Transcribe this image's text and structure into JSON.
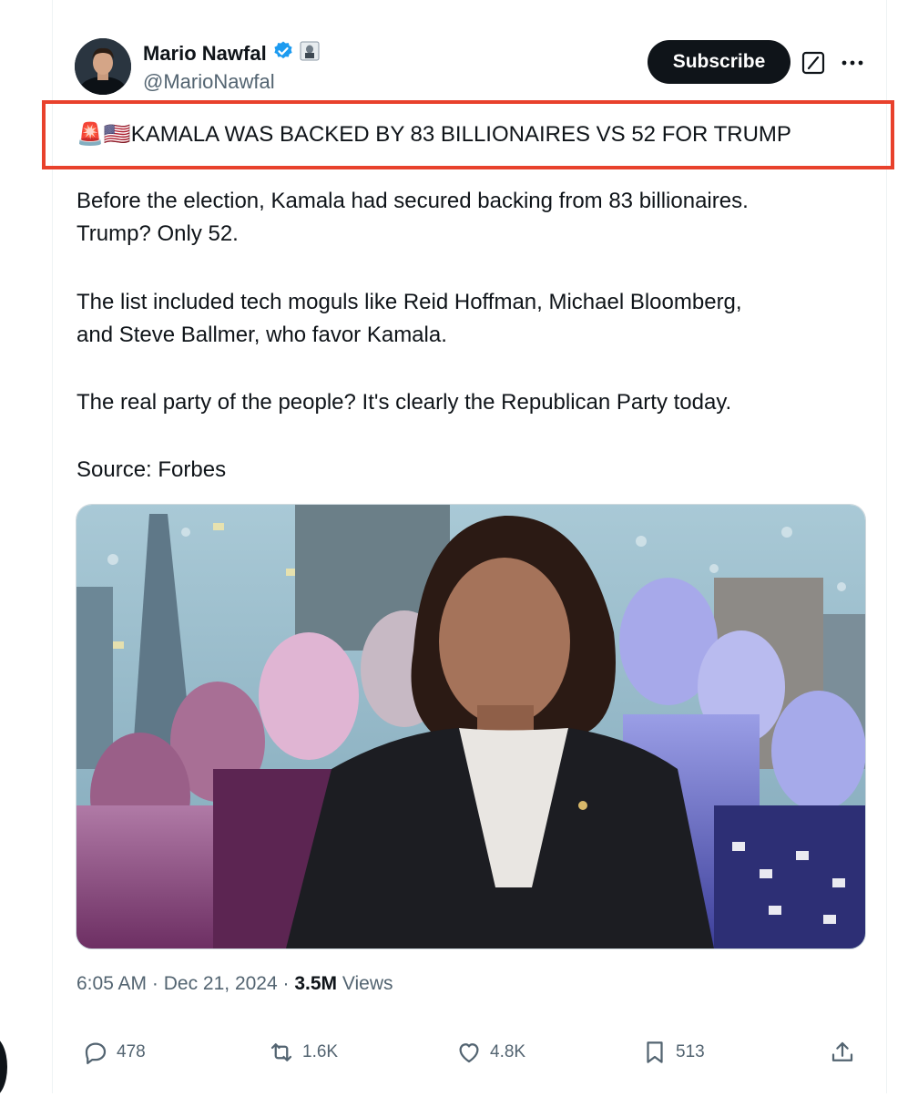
{
  "author": {
    "name": "Mario Nawfal",
    "handle": "@MarioNawfal",
    "verified_icon": "verified-badge-icon",
    "affiliate_icon": "affiliate-badge-icon"
  },
  "header": {
    "subscribe_label": "Subscribe",
    "grok_icon": "grok-icon",
    "more_icon": "more-icon"
  },
  "tweet": {
    "headline_emoji_1": "🚨",
    "headline_emoji_2": "🇺🇸",
    "headline_text": "KAMALA WAS BACKED BY 83 BILLIONAIRES VS 52 FOR TRUMP",
    "para_1_line_1": "Before the election, Kamala had secured backing from 83 billionaires.",
    "para_1_line_2": "Trump? Only 52.",
    "para_2_line_1": "The list included tech moguls like Reid Hoffman, Michael Bloomberg,",
    "para_2_line_2": "and Steve Ballmer, who favor Kamala.",
    "para_3": "The real party of the people? It's clearly the Republican Party today.",
    "source": "Source: Forbes"
  },
  "meta": {
    "time": "6:05 AM",
    "sep1": " · ",
    "date": "Dec 21, 2024",
    "sep2": " · ",
    "views_count": "3.5M",
    "views_label": " Views"
  },
  "actions": {
    "replies": "478",
    "reposts": "1.6K",
    "likes": "4.8K",
    "bookmarks": "513"
  },
  "colors": {
    "accent": "#1d9bf0",
    "highlight_border": "#e8412c",
    "text_primary": "#0f1419",
    "text_secondary": "#536471"
  }
}
